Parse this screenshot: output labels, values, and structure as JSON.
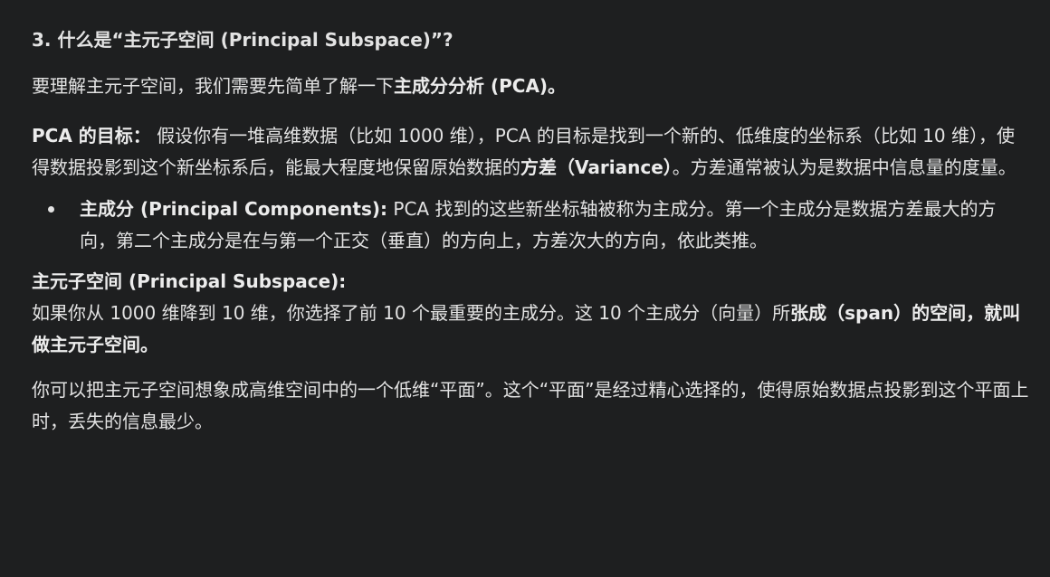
{
  "heading": "3. 什么是“主元子空间 (Principal Subspace)”?",
  "intro": {
    "text": "要理解主元子空间，我们需要先简单了解一下",
    "bold": "主成分分析 (PCA)。"
  },
  "pca_goal": {
    "label": "PCA 的目标：",
    "text_1": " 假设你有一堆高维数据（比如 1000 维），PCA 的目标是找到一个新的、低维度的坐标系（比如 10 维），使得数据投影到这个新坐标系后，能最大程度地保留原始数据的",
    "bold_variance": "方差（Variance）",
    "text_2": "。方差通常被认为是数据中信息量的度量。"
  },
  "bullets": [
    {
      "label": "主成分 (Principal Components):",
      "text": " PCA 找到的这些新坐标轴被称为主成分。第一个主成分是数据方差最大的方向，第二个主成分是在与第一个正交（垂直）的方向上，方差次大的方向，依此类推。"
    }
  ],
  "subspace": {
    "label": "主元子空间 (Principal Subspace):",
    "text": "如果你从 1000 维降到 10 维，你选择了前 10 个最重要的主成分。这 10 个主成分（向量）所",
    "bold_1": "张成",
    "bold_2": "（span）的空间，就叫做主元子空间。"
  },
  "closing": "你可以把主元子空间想象成高维空间中的一个低维“平面”。这个“平面”是经过精心选择的，使得原始数据点投影到这个平面上时，丢失的信息最少。"
}
